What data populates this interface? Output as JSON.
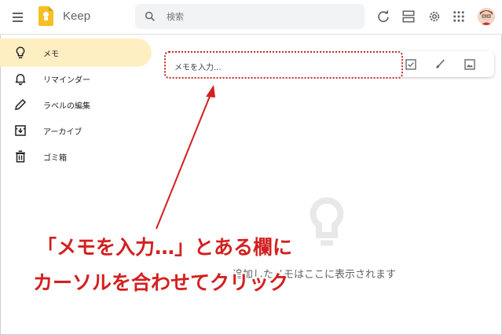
{
  "header": {
    "app_title": "Keep",
    "search_placeholder": "検索"
  },
  "sidebar": {
    "items": [
      {
        "label": "メモ",
        "icon": "lightbulb-icon",
        "active": true
      },
      {
        "label": "リマインダー",
        "icon": "bell-icon",
        "active": false
      },
      {
        "label": "ラベルの編集",
        "icon": "pencil-icon",
        "active": false
      },
      {
        "label": "アーカイブ",
        "icon": "archive-icon",
        "active": false
      },
      {
        "label": "ゴミ箱",
        "icon": "trash-icon",
        "active": false
      }
    ]
  },
  "note_input": {
    "placeholder": "メモを入力..."
  },
  "note_tools": [
    "checkbox-icon",
    "brush-icon",
    "image-icon"
  ],
  "empty_state": {
    "text": "追加したメモはここに表示されます"
  },
  "annotation": {
    "line1": "「メモを入力…」とある欄に",
    "line2": "カーソルを合わせてクリック",
    "color": "#d41f1f"
  },
  "colors": {
    "accent_active": "#feefc3",
    "logo": "#f6bf26"
  }
}
